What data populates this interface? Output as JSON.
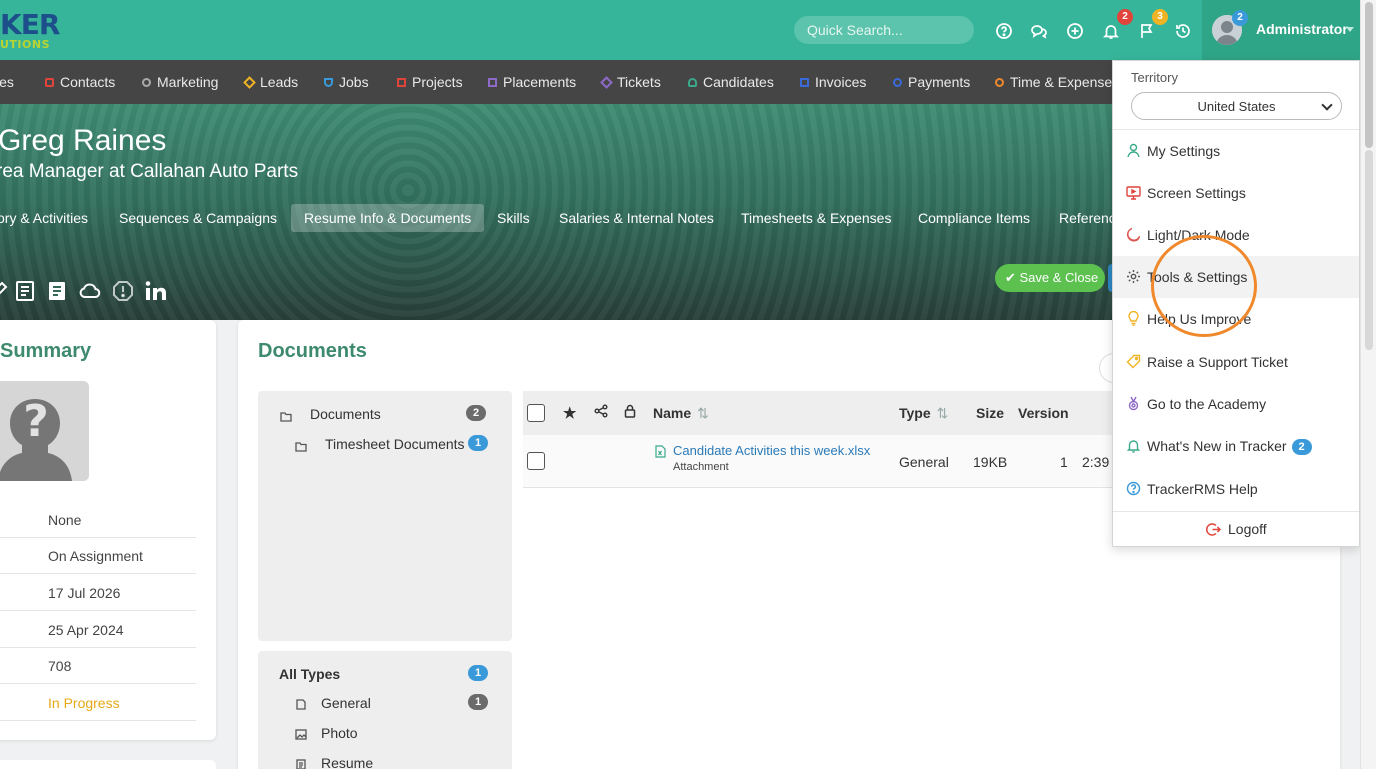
{
  "brand": {
    "logo_text": "KER",
    "logo_sub": "UTIONS"
  },
  "topbar": {
    "search_placeholder": "Quick Search...",
    "icons": [
      "help-icon",
      "chat-icon",
      "add-icon",
      "bell-icon",
      "flag-icon",
      "history-icon"
    ],
    "bell_badge": "2",
    "flag_badge": "3",
    "avatar_badge": "2",
    "user_name": "Administrator"
  },
  "module_nav": [
    "ies",
    "Contacts",
    "Marketing",
    "Leads",
    "Jobs",
    "Projects",
    "Placements",
    "Tickets",
    "Candidates",
    "Invoices",
    "Payments",
    "Time & Expense"
  ],
  "record": {
    "name": "Greg Raines",
    "title": "rea Manager at Callahan Auto Parts",
    "tabs": [
      "ory & Activities",
      "Sequences & Campaigns",
      "Resume Info & Documents",
      "Skills",
      "Salaries & Internal Notes",
      "Timesheets & Expenses",
      "Compliance Items",
      "Referenc"
    ],
    "active_tab": "Resume Info & Documents",
    "save_close": "Save & Close"
  },
  "summary": {
    "heading": "Summary",
    "values": [
      "None",
      "On Assignment",
      "17 Jul 2026",
      "25 Apr 2024",
      "708",
      "In Progress"
    ],
    "status_color": "#e6a817"
  },
  "documents": {
    "heading": "Documents",
    "folders": [
      {
        "label": "Documents",
        "count": "2"
      },
      {
        "label": "Timesheet Documents",
        "count": "1"
      }
    ],
    "types_heading": "All Types",
    "types_count": "1",
    "types": [
      {
        "label": "General",
        "count": "1"
      },
      {
        "label": "Photo",
        "count": ""
      },
      {
        "label": "Resume",
        "count": ""
      }
    ],
    "columns": {
      "name": "Name",
      "type": "Type",
      "size": "Size",
      "version": "Version"
    },
    "rows": [
      {
        "name": "Candidate Activities this week.xlsx",
        "sub": "Attachment",
        "type": "General",
        "size": "19KB",
        "version": "1",
        "time": "2:39"
      }
    ]
  },
  "dropdown": {
    "territory_label": "Territory",
    "territory_value": "United States",
    "items": [
      {
        "label": "My Settings",
        "icon": "user-icon",
        "color": "#3aa98a"
      },
      {
        "label": "Screen Settings",
        "icon": "monitor-icon",
        "color": "#e0443a"
      },
      {
        "label": "Light/Dark Mode",
        "icon": "moon-icon",
        "color": "#d9534f"
      },
      {
        "label": "Tools & Settings",
        "icon": "gear-icon",
        "color": "#555555"
      },
      {
        "label": "Help Us Improve",
        "icon": "lightbulb-icon",
        "color": "#f0b323"
      },
      {
        "label": "Raise a Support Ticket",
        "icon": "tag-icon",
        "color": "#f0b323"
      },
      {
        "label": "Go to the Academy",
        "icon": "medal-icon",
        "color": "#8e6ac8"
      },
      {
        "label": "What's New in Tracker",
        "icon": "bell-icon",
        "color": "#3aa98a",
        "badge": "2"
      },
      {
        "label": "TrackerRMS Help",
        "icon": "help-icon",
        "color": "#3a9ad9"
      }
    ],
    "logoff": "Logoff"
  },
  "colors": {
    "topbar": "#37b59a",
    "accent_green": "#3e8a6e",
    "highlight": "#f0882c",
    "link_blue": "#2a7ab8"
  }
}
